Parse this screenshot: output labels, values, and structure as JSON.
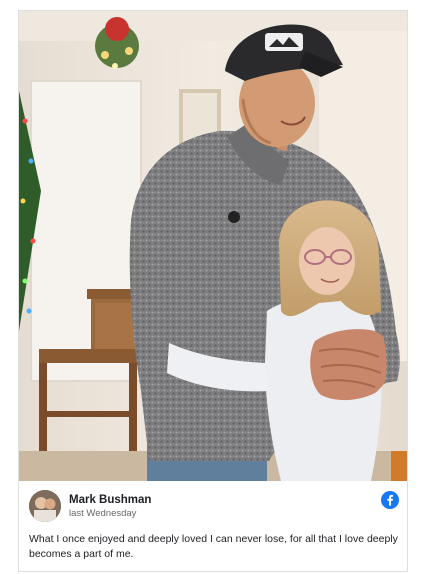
{
  "post": {
    "author": "Mark Bushman",
    "time": "last Wednesday",
    "text": "What I once enjoyed and deeply loved I can never lose, for all that I love deeply becomes a part of me."
  },
  "colors": {
    "facebook_blue": "#1877f2",
    "card_border": "#dddfe2",
    "meta_gray": "#65676b"
  },
  "icons": {
    "platform": "facebook-icon"
  }
}
